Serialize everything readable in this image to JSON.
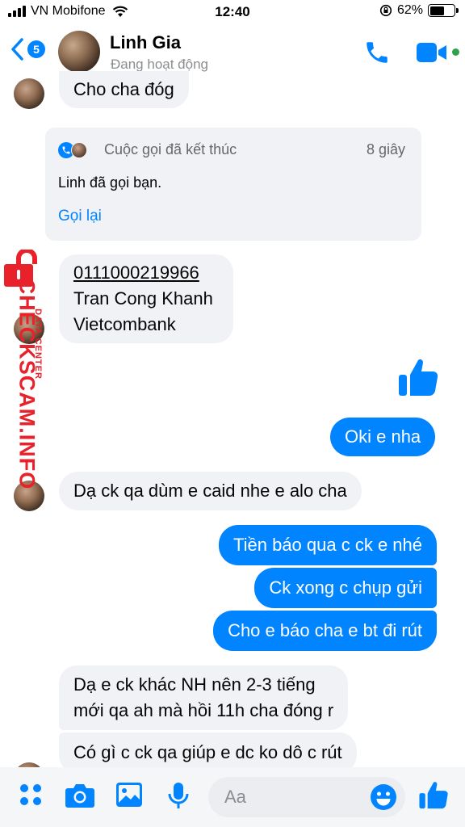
{
  "status_bar": {
    "carrier": "VN Mobifone",
    "time": "12:40",
    "battery_percent": "62%",
    "battery_level": 0.62
  },
  "header": {
    "back_count": "5",
    "contact_name": "Linh Gia",
    "contact_status": "Đang hoạt động"
  },
  "messages": [
    {
      "side": "in",
      "text": "Cho cha đóg"
    },
    {
      "type": "call",
      "title": "Cuộc gọi đã kết thúc",
      "duration": "8 giây",
      "description": "Linh đã gọi bạn.",
      "action": "Gọi lại"
    },
    {
      "side": "in",
      "lines": [
        "0111000219966",
        "Tran Cong Khanh",
        "Vietcombank"
      ]
    },
    {
      "side": "out",
      "type": "like"
    },
    {
      "side": "out",
      "text": "Oki e nha"
    },
    {
      "side": "in",
      "text": "Dạ ck qa dùm e caid nhe e alo cha"
    },
    {
      "side": "out",
      "text": "Tiền báo qua c ck e nhé"
    },
    {
      "side": "out",
      "text": "Ck xong c chụp gửi"
    },
    {
      "side": "out",
      "text": "Cho e báo cha e bt đi rút"
    },
    {
      "side": "in",
      "lines": [
        "Dạ e ck khác NH nên 2-3 tiếng",
        "mới qa ah mà hồi 11h cha đóng r"
      ]
    },
    {
      "side": "in",
      "text": "Có gì c ck qa giúp e dc ko dô c rút"
    }
  ],
  "watermark": {
    "main": "CHECKSCAM.INFO",
    "sub": "DATA CENTER"
  },
  "composer": {
    "placeholder": "Aa"
  },
  "colors": {
    "accent": "#0084ff",
    "incoming_bubble": "#f0f2f5",
    "watermark": "#e8212a",
    "active": "#31a24c"
  },
  "icons": [
    "back-chevron-icon",
    "phone-icon",
    "video-camera-icon",
    "thumbs-up-icon",
    "grid-dots-icon",
    "camera-icon",
    "image-icon",
    "microphone-icon",
    "emoji-icon",
    "lock-icon"
  ]
}
